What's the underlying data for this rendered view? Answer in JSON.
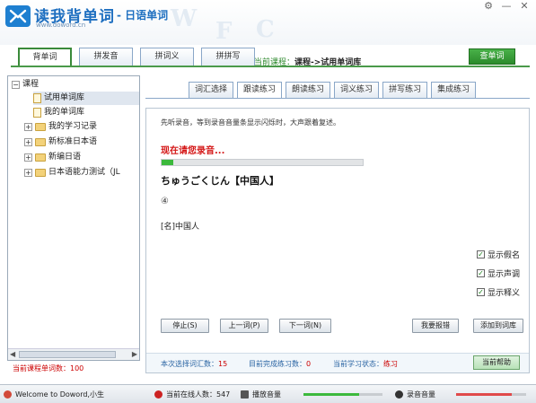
{
  "app": {
    "title": "读我背单词",
    "subtitle": "- 日语单词",
    "url": "www.doword.cn",
    "bg_letters": [
      "W",
      "F",
      "C"
    ],
    "window_controls": [
      "⚙",
      "—",
      "✕"
    ]
  },
  "top_tabs": [
    {
      "label": "背单词",
      "active": true
    },
    {
      "label": "拼发音",
      "active": false
    },
    {
      "label": "拼词义",
      "active": false
    },
    {
      "label": "拼拼写",
      "active": false
    }
  ],
  "course": {
    "prefix": "当前课程：",
    "path": "课程->试用单词库"
  },
  "lookup_label": "查单词",
  "tree": {
    "root": "课程",
    "items": [
      {
        "label": "试用单词库",
        "type": "doc",
        "selected": true
      },
      {
        "label": "我的单词库",
        "type": "doc",
        "selected": false
      },
      {
        "label": "我的学习记录",
        "type": "folder",
        "selected": false
      },
      {
        "label": "新标准日本语",
        "type": "folder",
        "selected": false
      },
      {
        "label": "新编日语",
        "type": "folder",
        "selected": false
      },
      {
        "label": "日本语能力测试（JL",
        "type": "folder",
        "selected": false
      }
    ]
  },
  "word_count_label": "当前课程单词数：100",
  "practice_tabs": [
    {
      "label": "词汇选择",
      "active": false
    },
    {
      "label": "跟读练习",
      "active": true
    },
    {
      "label": "朗读练习",
      "active": false
    },
    {
      "label": "词义练习",
      "active": false
    },
    {
      "label": "拼写练习",
      "active": false
    },
    {
      "label": "集成练习",
      "active": false
    }
  ],
  "panel": {
    "instruction": "先听录音，等到录音音量条显示闪烁时，大声跟着复述。",
    "recording_text": "现在请您录音...",
    "progress": 0.06,
    "kana": "ちゅうごくじん【中国人】",
    "accent_mark": "④",
    "meaning": "[名]中国人",
    "checks": [
      {
        "label": "显示假名",
        "checked": true
      },
      {
        "label": "显示声调",
        "checked": true
      },
      {
        "label": "显示释义",
        "checked": true
      }
    ],
    "buttons": {
      "stop": "停止(S)",
      "prev": "上一词(P)",
      "next": "下一词(N)",
      "report": "我要报错",
      "add": "添加到词库"
    },
    "stats": {
      "selected_label": "本次选择词汇数：",
      "selected_value": "15",
      "done_label": "目前完成练习数：",
      "done_value": "0",
      "state_label": "当前学习状态：",
      "state_value": "练习"
    },
    "help_label": "当前帮助"
  },
  "statusbar": {
    "welcome": "Welcome to Doword,小生",
    "online": "当前在线人数：547",
    "play_volume": "播放音量",
    "record_volume": "录音音量",
    "play_level": 0.7,
    "record_level": 0.8
  },
  "colors": {
    "brand_blue": "#1e6fc0",
    "green": "#3a8a3a",
    "alert_red": "#d41616"
  }
}
